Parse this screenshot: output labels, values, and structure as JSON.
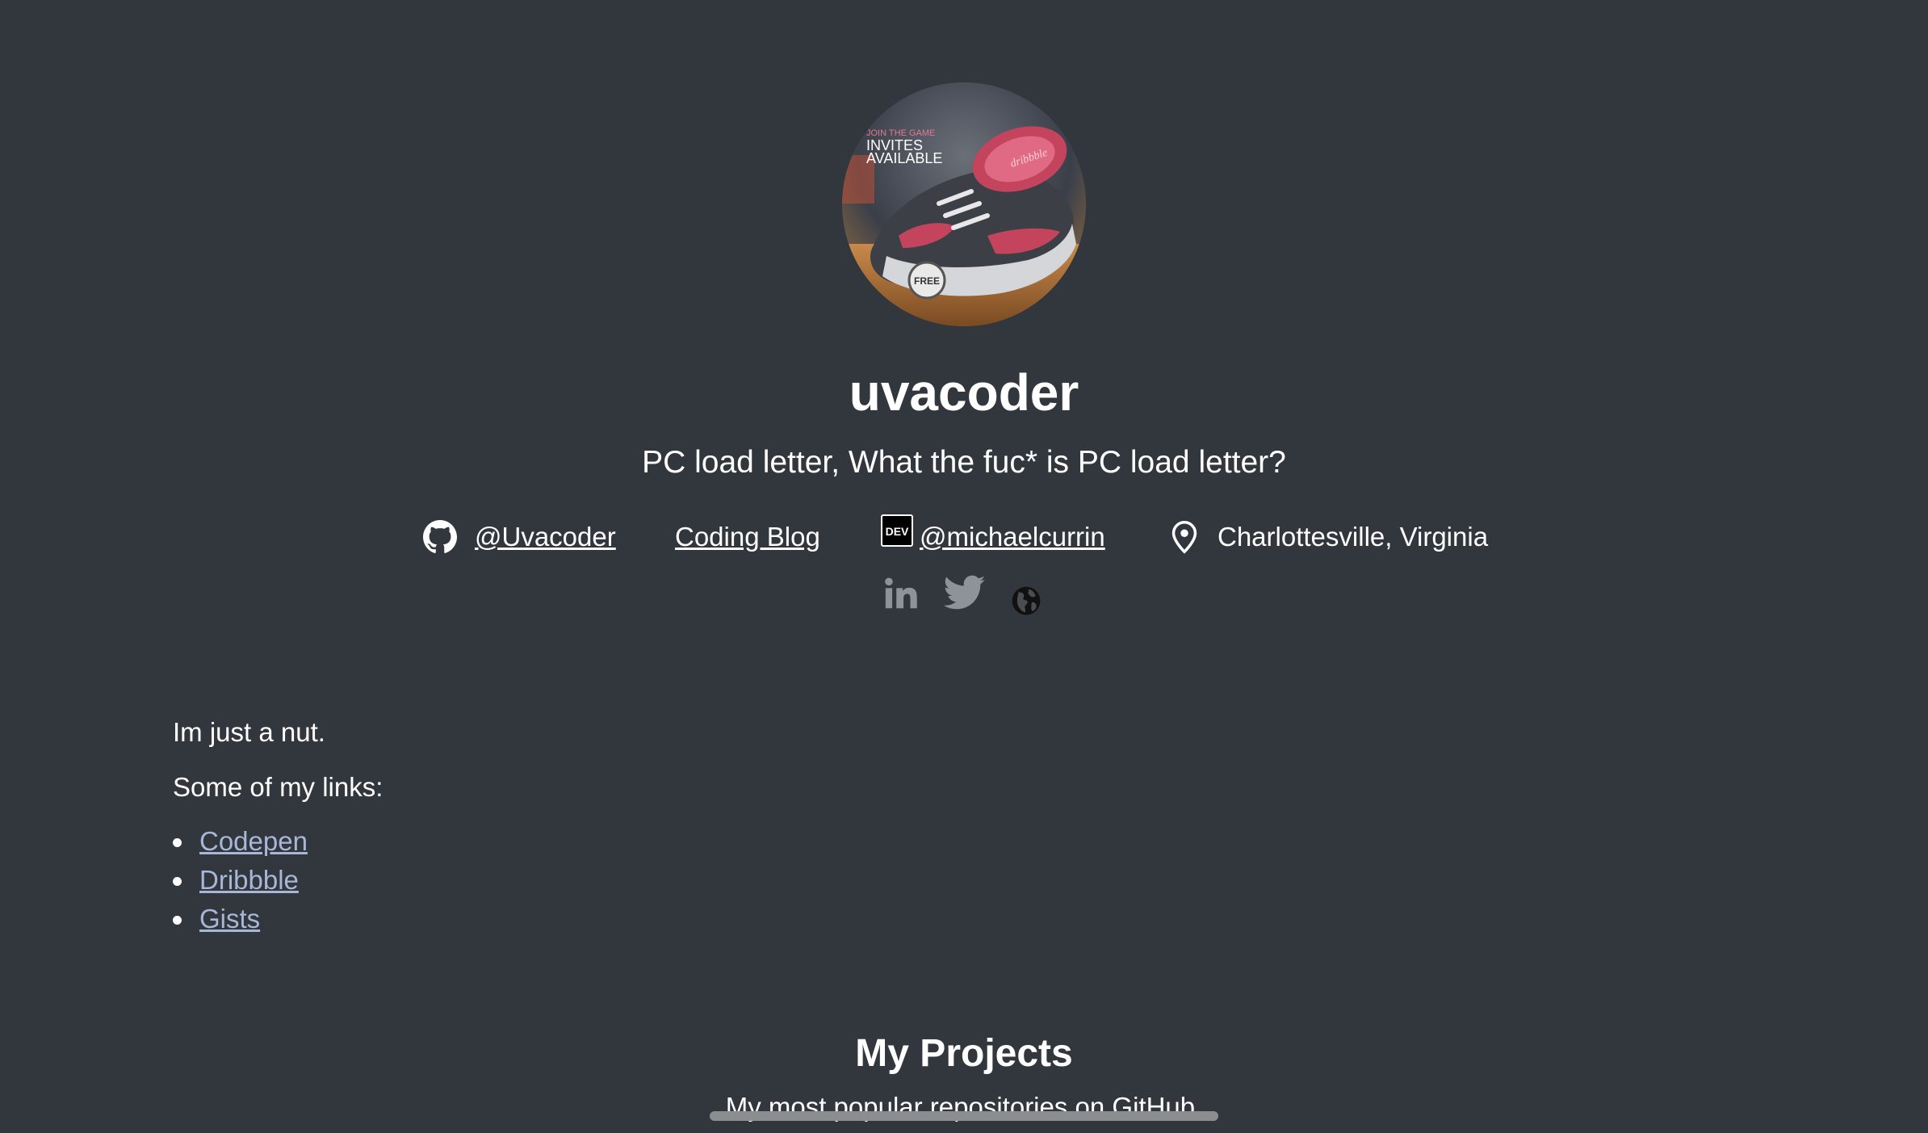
{
  "profile": {
    "avatar_alt": "dribbble invite sneaker",
    "avatar_text": {
      "line1": "JOIN THE GAME",
      "line2": "INVITES",
      "line3": "AVAILABLE",
      "brand": "dribbble",
      "tag": "FREE"
    },
    "username": "uvacoder",
    "tagline": "PC load letter, What the fuc* is PC load letter?"
  },
  "meta": {
    "github_handle": "@Uvacoder",
    "blog_label": "Coding Blog",
    "dev_badge": "DEV",
    "dev_handle": "@michaelcurrin",
    "location": "Charlottesville, Virginia"
  },
  "social": {
    "icons": [
      "linkedin-icon",
      "twitter-icon",
      "globe-icon"
    ]
  },
  "about": {
    "intro": "Im just a nut.",
    "links_heading": "Some of my links:",
    "links": [
      {
        "label": "Codepen"
      },
      {
        "label": "Dribbble"
      },
      {
        "label": "Gists"
      }
    ]
  },
  "projects": {
    "title": "My Projects",
    "subtitle": "My most popular repositories on GitHub."
  },
  "colors": {
    "background": "#32363d",
    "text": "#ffffff",
    "link": "#a8b7d8",
    "muted_icon": "#8e9299"
  }
}
